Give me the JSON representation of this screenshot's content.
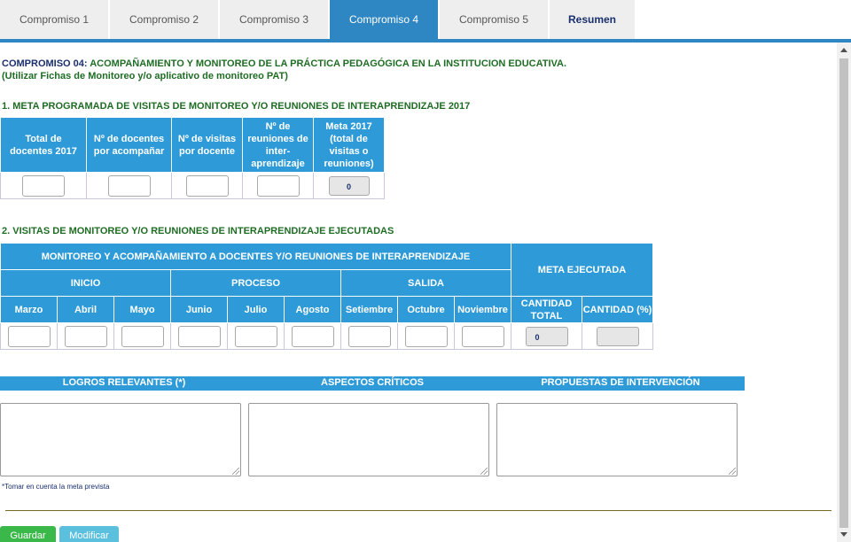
{
  "tabs": [
    {
      "label": "Compromiso 1"
    },
    {
      "label": "Compromiso 2"
    },
    {
      "label": "Compromiso 3"
    },
    {
      "label": "Compromiso 4"
    },
    {
      "label": "Compromiso 5"
    },
    {
      "label": "Resumen"
    }
  ],
  "heading": {
    "number": "COMPROMISO 04:",
    "title": " ACOMPAÑAMIENTO Y MONITOREO DE LA PRÁCTICA PEDAGÓGICA EN LA INSTITUCION EDUCATIVA.",
    "subtitle": "(Utilizar Fichas de Monitoreo y/o aplicativo de monitoreo PAT)"
  },
  "section1": {
    "title": "1. META PROGRAMADA DE VISITAS DE MONITOREO Y/O REUNIONES DE INTERAPRENDIZAJE 2017",
    "headers": [
      "Total de docentes 2017",
      "Nº de docentes por acompañar",
      "Nº de visitas por docente",
      "Nº de reuniones de inter-aprendizaje",
      "Meta 2017 (total de visitas o reuniones)"
    ],
    "meta_value": "0"
  },
  "section2": {
    "title": "2. VISITAS DE MONITOREO Y/O REUNIONES DE INTERAPRENDIZAJE EJECUTADAS",
    "group_header": "MONITOREO Y ACOMPAÑAMIENTO A DOCENTES Y/O REUNIONES DE INTERAPRENDIZAJE",
    "meta_header": "META EJECUTADA",
    "stages": [
      "INICIO",
      "PROCESO",
      "SALIDA"
    ],
    "months": [
      "Marzo",
      "Abril",
      "Mayo",
      "Junio",
      "Julio",
      "Agosto",
      "Setiembre",
      "Octubre",
      "Noviembre"
    ],
    "total_header": "CANTIDAD TOTAL",
    "percent_header": "CANTIDAD (%)",
    "total_value": "0"
  },
  "section3": {
    "headers": [
      "LOGROS RELEVANTES (*)",
      "ASPECTOS CRÍTICOS",
      "PROPUESTAS DE INTERVENCIÓN"
    ],
    "note": "*Tomar en cuenta la meta prevista"
  },
  "buttons": {
    "save": "Guardar",
    "edit": "Modificar"
  }
}
